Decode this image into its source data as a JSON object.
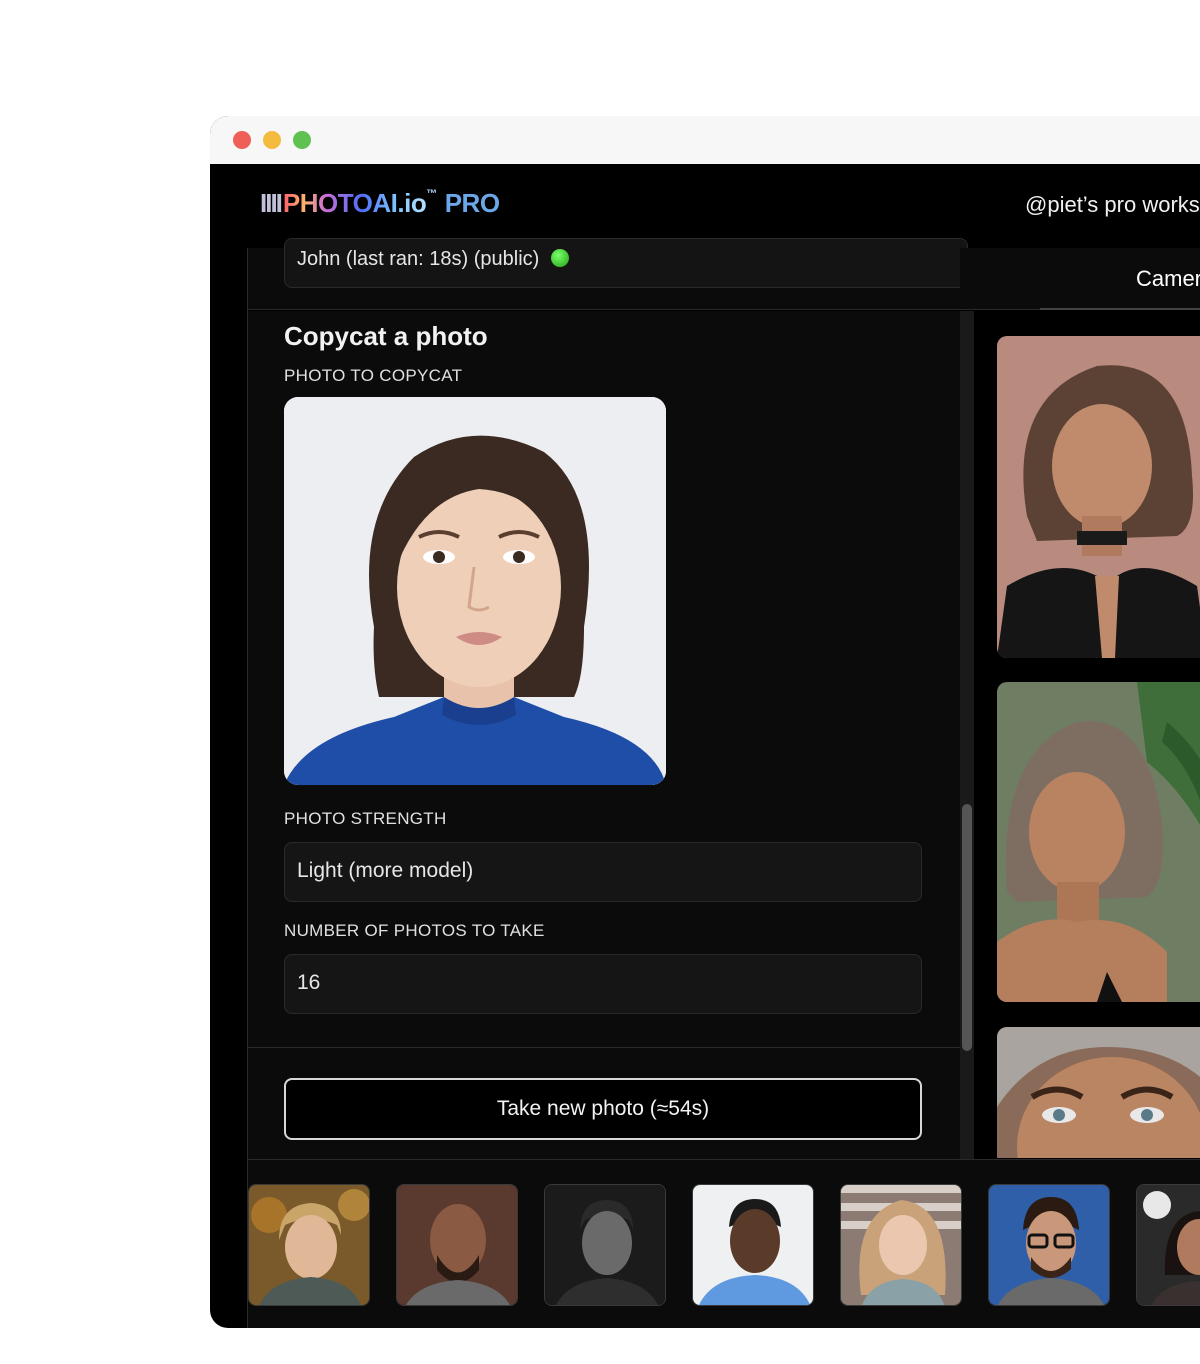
{
  "app": {
    "logo_bars": "IIII",
    "logo_name": "PHOTOAI.io",
    "logo_tm": "™",
    "logo_pro": "PRO",
    "workspace": "@piet’s pro works"
  },
  "model_selector": {
    "value": "John (last ran: 18s) (public)",
    "status_color": "#22c016"
  },
  "tabs": {
    "camera": "Camer"
  },
  "copycat": {
    "heading": "Copycat a photo",
    "photo_label": "PHOTO TO COPYCAT",
    "strength_label": "PHOTO STRENGTH",
    "strength_value": "Light (more model)",
    "count_label": "NUMBER OF PHOTOS TO TAKE",
    "count_value": "16"
  },
  "actions": {
    "take_photo": "Take new photo (≈54s)"
  },
  "colors": {
    "accent": "#6aa7e8",
    "background": "#000000",
    "panel": "#0b0b0b"
  }
}
